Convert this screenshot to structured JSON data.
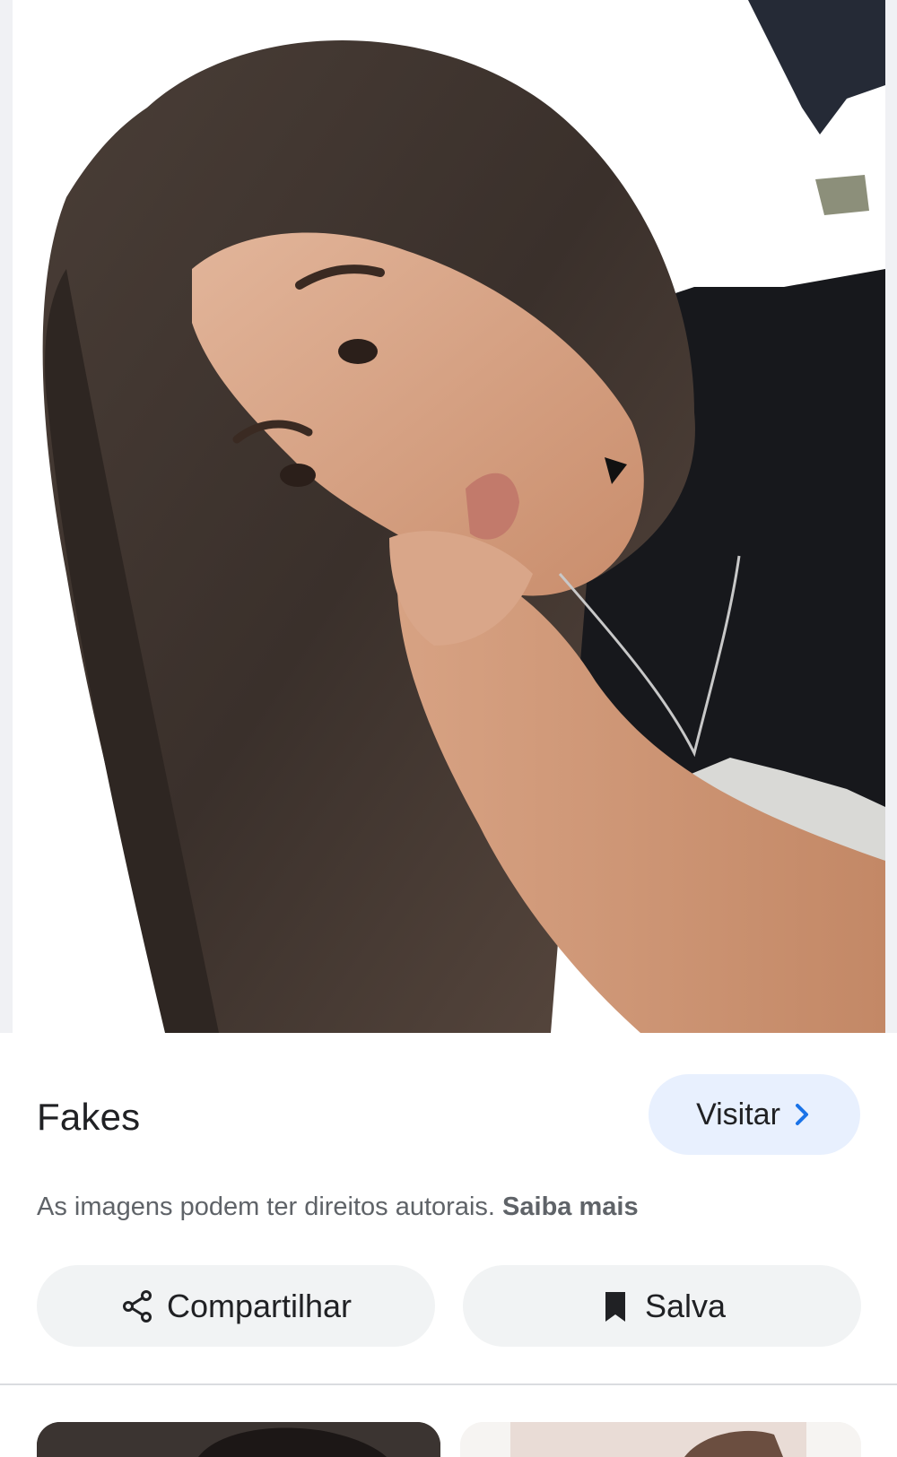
{
  "pin": {
    "title": "Fakes",
    "visit_label": "Visitar",
    "visit_icon": "chevron-right-icon",
    "accent_color": "#1a73e8"
  },
  "copyright": {
    "text": "As imagens podem ter direitos autorais.",
    "link": "Saiba mais"
  },
  "actions": {
    "share": {
      "label": "Compartilhar",
      "icon": "share-icon"
    },
    "save": {
      "label": "Salva",
      "icon": "bookmark-icon"
    }
  },
  "colors": {
    "visit_button_bg": "#e8f0fe",
    "action_button_bg": "#f1f3f4",
    "text_primary": "#202124",
    "text_secondary": "#5f6368"
  }
}
